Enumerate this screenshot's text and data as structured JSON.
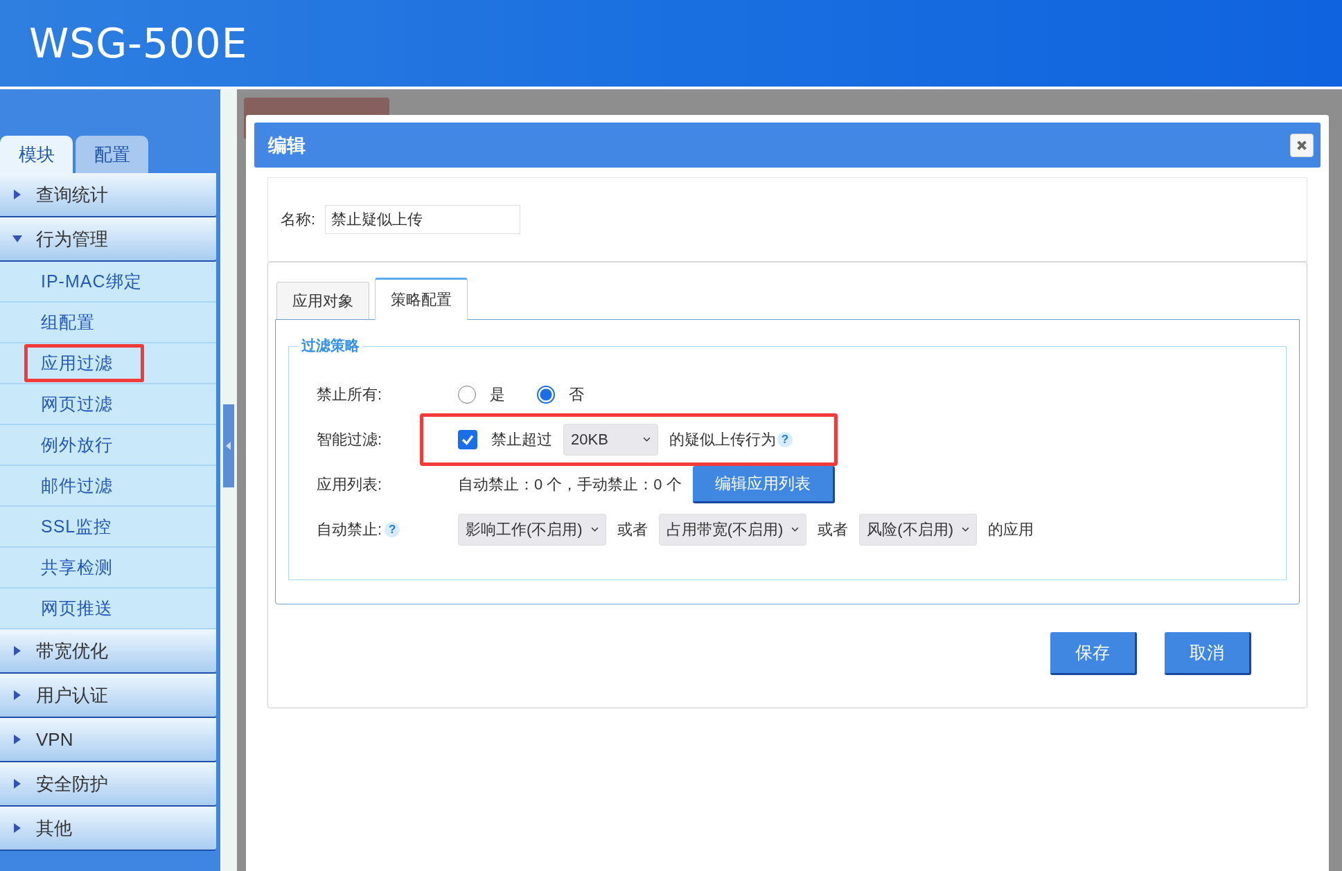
{
  "header": {
    "title": "WSG-500E"
  },
  "sidebar": {
    "tabs": [
      {
        "label": "模块",
        "selected": true
      },
      {
        "label": "配置",
        "selected": false
      }
    ],
    "groups": [
      {
        "label": "查询统计",
        "expanded": false
      },
      {
        "label": "行为管理",
        "expanded": true,
        "children": [
          {
            "label": "IP-MAC绑定",
            "annotated": false
          },
          {
            "label": "组配置",
            "annotated": false
          },
          {
            "label": "应用过滤",
            "annotated": true
          },
          {
            "label": "网页过滤",
            "annotated": false
          },
          {
            "label": "例外放行",
            "annotated": false
          },
          {
            "label": "邮件过滤",
            "annotated": false
          },
          {
            "label": "SSL监控",
            "annotated": false
          },
          {
            "label": "共享检测",
            "annotated": false
          },
          {
            "label": "网页推送",
            "annotated": false
          }
        ]
      },
      {
        "label": "带宽优化",
        "expanded": false
      },
      {
        "label": "用户认证",
        "expanded": false
      },
      {
        "label": "VPN",
        "expanded": false
      },
      {
        "label": "安全防护",
        "expanded": false
      },
      {
        "label": "其他",
        "expanded": false
      }
    ]
  },
  "dialog": {
    "title": "编辑",
    "name_label": "名称:",
    "name_value": "禁止疑似上传",
    "tabs": [
      {
        "label": "应用对象",
        "selected": false
      },
      {
        "label": "策略配置",
        "selected": true
      }
    ],
    "legend": "过滤策略",
    "rows": [
      {
        "label": "禁止所有:",
        "annotated": false,
        "items": [
          {
            "kind": "radio",
            "label": "是",
            "selected": false
          },
          {
            "kind": "radio",
            "label": "否",
            "selected": true
          }
        ]
      },
      {
        "label": "智能过滤:",
        "annotated": true,
        "items": [
          {
            "kind": "checkbox",
            "label": "禁止超过",
            "checked": true
          },
          {
            "kind": "select",
            "value": "20KB"
          },
          {
            "kind": "text",
            "text": "的疑似上传行为"
          },
          {
            "kind": "help",
            "text": "?"
          }
        ]
      },
      {
        "label": "应用列表:",
        "annotated": false,
        "items": [
          {
            "kind": "text",
            "text": "自动禁止：0 个，手动禁止：0 个"
          },
          {
            "kind": "button",
            "label": "编辑应用列表"
          }
        ]
      },
      {
        "label": "自动禁止:",
        "help": "?",
        "annotated": false,
        "items": [
          {
            "kind": "select",
            "value": "影响工作(不启用)"
          },
          {
            "kind": "text",
            "text": "或者"
          },
          {
            "kind": "select",
            "value": "占用带宽(不启用)"
          },
          {
            "kind": "text",
            "text": "或者"
          },
          {
            "kind": "select",
            "value": "风险(不启用)"
          },
          {
            "kind": "text",
            "text": "的应用"
          }
        ]
      }
    ],
    "buttons": [
      "保存",
      "取消"
    ]
  }
}
